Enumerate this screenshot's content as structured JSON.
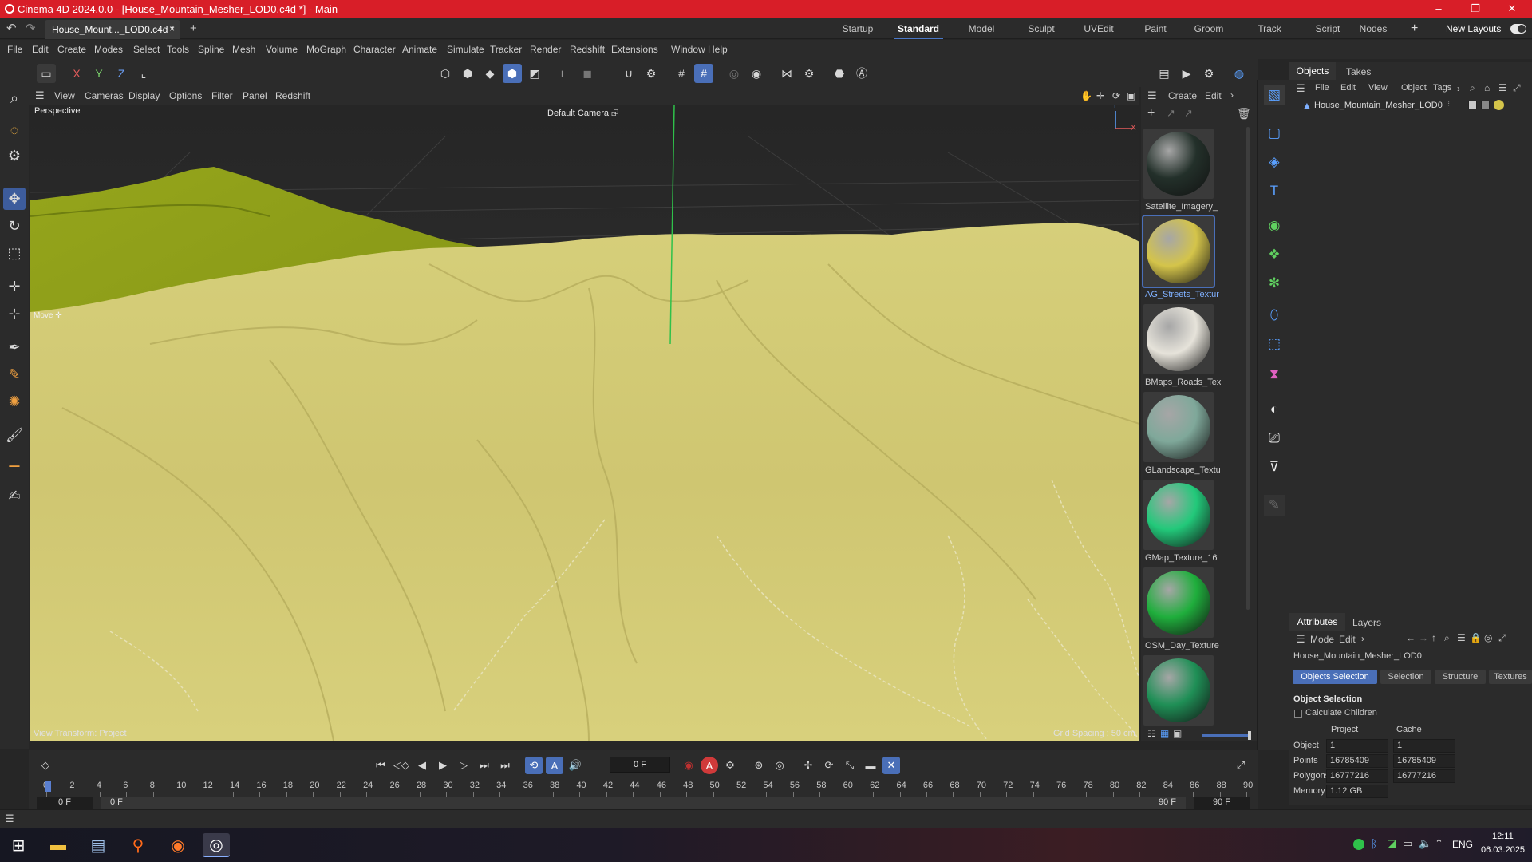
{
  "window": {
    "title": "Cinema 4D 2024.0.0 - [House_Mountain_Mesher_LOD0.c4d *] - Main",
    "minimize": "–",
    "maximize": "❐",
    "close": "✕"
  },
  "doc_tab": {
    "label": "House_Mount..._LOD0.c4d *",
    "close": "×",
    "add": "+"
  },
  "layouts": {
    "items": [
      "Startup",
      "Standard",
      "Model",
      "Sculpt",
      "UVEdit",
      "Paint",
      "Groom",
      "Track",
      "Script",
      "Nodes"
    ],
    "active": "Standard",
    "add": "+",
    "new_layouts": "New Layouts"
  },
  "menu": [
    "File",
    "Edit",
    "Create",
    "Modes",
    "Select",
    "Tools",
    "Spline",
    "Mesh",
    "Volume",
    "MoGraph",
    "Character",
    "Animate",
    "Simulate",
    "Tracker",
    "Render",
    "Redshift",
    "Extensions",
    "Window",
    "Help"
  ],
  "axis_toggles": [
    "X",
    "Y",
    "Z"
  ],
  "viewport_menu": [
    "View",
    "Cameras",
    "Display",
    "Options",
    "Filter",
    "Panel",
    "Redshift"
  ],
  "viewport": {
    "view_name": "Perspective",
    "camera": "Default Camera",
    "camera_icon": "⮺",
    "tool_label": "Move",
    "tool_icon": "✛",
    "transform_label": "View Transform: Project",
    "grid_spacing": "Grid Spacing : 50 cm",
    "axis_y": "Y",
    "axis_x": "X"
  },
  "material_panel": {
    "menu": [
      "Create",
      "Edit"
    ],
    "more": "›",
    "add": "+",
    "materials": [
      {
        "name": "Satellite_Imagery_",
        "color": "#23302a"
      },
      {
        "name": "AG_Streets_Textur",
        "color": "#d4c44a"
      },
      {
        "name": "BMaps_Roads_Tex",
        "color": "#e6e3da"
      },
      {
        "name": "GLandscape_Textu",
        "color": "#7fa89a"
      },
      {
        "name": "GMap_Texture_16",
        "color": "#22c97a"
      },
      {
        "name": "OSM_Day_Texture",
        "color": "#1fae3c"
      },
      {
        "name": "",
        "color": "#1f8f56"
      }
    ]
  },
  "objects_panel": {
    "tabs": [
      "Objects",
      "Takes"
    ],
    "menu": [
      "File",
      "Edit",
      "View",
      "Object",
      "Tags"
    ],
    "more": "›",
    "object_name": "House_Mountain_Mesher_LOD0"
  },
  "attributes_panel": {
    "tabs": [
      "Attributes",
      "Layers"
    ],
    "menu": [
      "Mode",
      "Edit"
    ],
    "more": "›",
    "object_name": "House_Mountain_Mesher_LOD0",
    "subtabs": [
      "Objects Selection",
      "Selection",
      "Structure",
      "Textures"
    ],
    "section": "Object Selection",
    "calc_children": "Calculate Children",
    "col_project": "Project",
    "col_cache": "Cache",
    "rows": [
      {
        "label": "Object",
        "project": "1",
        "cache": "1"
      },
      {
        "label": "Points",
        "project": "16785409",
        "cache": "16785409"
      },
      {
        "label": "Polygons",
        "project": "16777216",
        "cache": "16777216"
      },
      {
        "label": "Memory",
        "project": "1.12 GB",
        "cache": ""
      }
    ]
  },
  "timeline": {
    "current_frame": "0 F",
    "ticks": [
      "0",
      "2",
      "4",
      "6",
      "8",
      "10",
      "12",
      "14",
      "16",
      "18",
      "20",
      "22",
      "24",
      "26",
      "28",
      "30",
      "32",
      "34",
      "36",
      "38",
      "40",
      "42",
      "44",
      "46",
      "48",
      "50",
      "52",
      "54",
      "56",
      "58",
      "60",
      "62",
      "64",
      "66",
      "68",
      "70",
      "72",
      "74",
      "76",
      "78",
      "80",
      "82",
      "84",
      "86",
      "88",
      "90"
    ],
    "start": "0 F",
    "range_start": "0 F",
    "range_end": "90 F",
    "end": "90 F"
  },
  "taskbar": {
    "lang": "ENG",
    "time": "12:11",
    "date": "06.03.2025"
  }
}
